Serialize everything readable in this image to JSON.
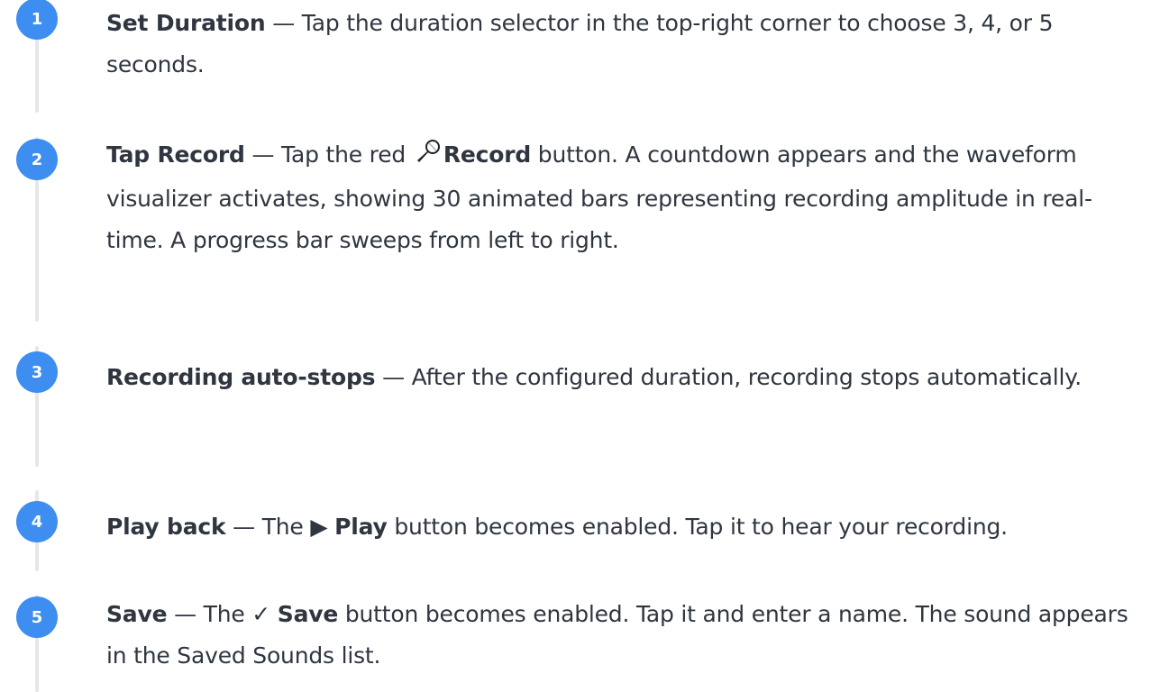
{
  "steps": [
    {
      "number": "1",
      "title": "Set Duration",
      "sep": " — ",
      "body": "Tap the duration selector in the top-right corner to choose 3, 4, or 5 seconds."
    },
    {
      "number": "2",
      "title": "Tap Record",
      "sep": " — ",
      "body_pre": "Tap the red ",
      "icon": "microphone-icon",
      "button_label": "Record",
      "body_post": " button. A countdown appears and the waveform visualizer activates, showing 30 animated bars representing recording amplitude in real-time. A progress bar sweeps from left to right."
    },
    {
      "number": "3",
      "title": "Recording auto-stops",
      "sep": " — ",
      "body": "After the configured duration, recording stops automatically."
    },
    {
      "number": "4",
      "title": "Play back",
      "sep": " — ",
      "body_pre": "The ",
      "icon_glyph": "▶",
      "button_label": "Play",
      "body_post": " button becomes enabled. Tap it to hear your recording."
    },
    {
      "number": "5",
      "title": "Save",
      "sep": " — ",
      "body_pre": "The ",
      "icon_glyph": "✓",
      "button_label": "Save",
      "body_post": " button becomes enabled. Tap it and enter a name. The sound appears in the Saved Sounds list."
    }
  ],
  "colors": {
    "badge": "#3d8ef0",
    "rail": "#e4e7ec",
    "text": "#2f3640"
  }
}
